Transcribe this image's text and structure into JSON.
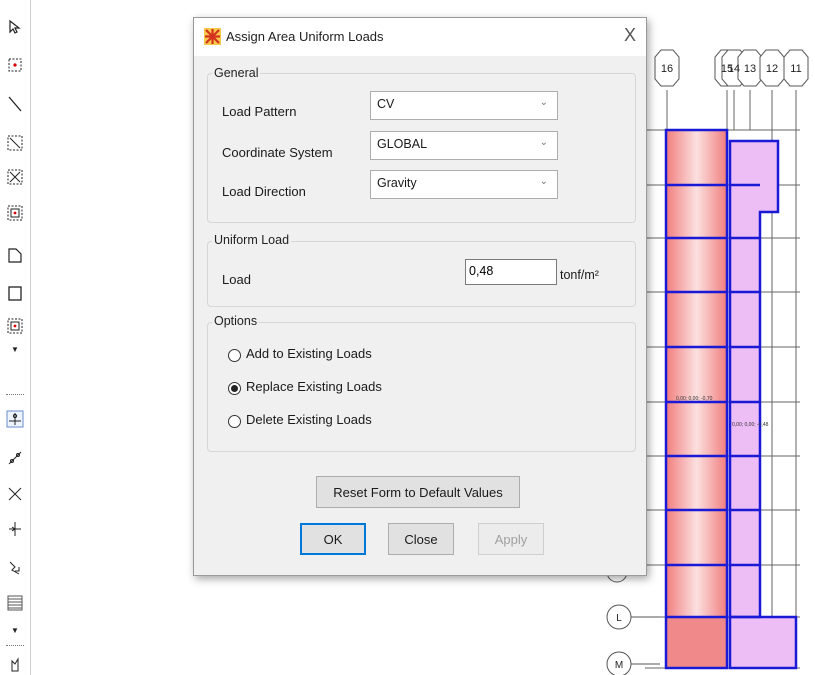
{
  "dialog": {
    "title": "Assign Area Uniform Loads",
    "close_glyph": "X",
    "general": {
      "label": "General",
      "load_pattern_label": "Load Pattern",
      "load_pattern_value": "CV",
      "coordinate_system_label": "Coordinate System",
      "coordinate_system_value": "GLOBAL",
      "load_direction_label": "Load Direction",
      "load_direction_value": "Gravity"
    },
    "uniform_load": {
      "label": "Uniform Load",
      "load_label": "Load",
      "load_value": "0,48",
      "unit": "tonf/m²"
    },
    "options": {
      "label": "Options",
      "items": [
        {
          "label": "Add to Existing Loads",
          "selected": false
        },
        {
          "label": "Replace Existing Loads",
          "selected": true
        },
        {
          "label": "Delete Existing Loads",
          "selected": false
        }
      ]
    },
    "buttons": {
      "reset": "Reset Form to Default Values",
      "ok": "OK",
      "close": "Close",
      "apply": "Apply"
    }
  },
  "drawing": {
    "grid_bubbles": [
      "16",
      "15",
      "14",
      "13",
      "12",
      "11"
    ],
    "row_bubbles": [
      "L",
      "M"
    ],
    "area_label_left": "0,00; 0,00; -0,70",
    "area_label_right": "0,00; 0,00; -0,48",
    "colors": {
      "area_red": "#f08a8a",
      "area_pink": "#edbdf5",
      "frame_blue": "#1a1ad6"
    }
  },
  "toolbar": {
    "icons": [
      "select-pointer-icon",
      "select-point-icon",
      "draw-line-icon",
      "select-region-icon",
      "cross-select-icon",
      "area-point-icon",
      "draw-polygon-icon",
      "draw-rectangle-icon",
      "quick-area-icon",
      "joint-icon",
      "draw-brace-icon",
      "draw-cross-brace-icon",
      "draw-link-icon",
      "draw-spring-icon",
      "hatch-area-icon",
      "draw-point-icon"
    ]
  }
}
